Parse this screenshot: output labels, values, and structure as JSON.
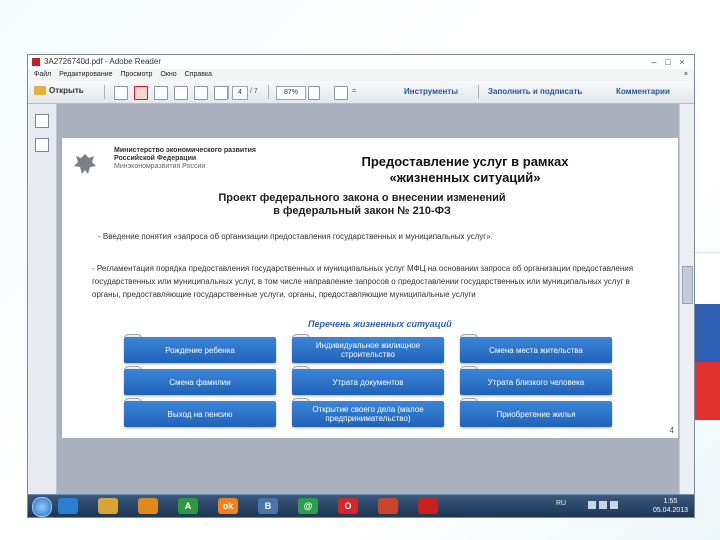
{
  "window": {
    "title": "3A2726740d.pdf - Adobe Reader",
    "minimize": "–",
    "maximize": "□",
    "close": "×"
  },
  "menubar": {
    "items": [
      "Файл",
      "Редактирование",
      "Просмотр",
      "Окно",
      "Справка"
    ],
    "close_doc": "×"
  },
  "toolbar": {
    "open_label": "Открыть",
    "page_current": "4",
    "page_total": "/ 7",
    "zoom": "87%",
    "tools": "Инструменты",
    "fill_sign": "Заполнить и подписать",
    "comments": "Комментарии"
  },
  "document": {
    "ministry_line1": "Министерство экономического развития",
    "ministry_line2": "Российской Федерации",
    "ministry_short": "Минэкономразвития России",
    "title_line1": "Предоставление услуг в рамках",
    "title_line2": "«жизненных ситуаций»",
    "project_line1": "Проект федерального закона о внесении изменений",
    "project_line2": "в федеральный закон № 210-ФЗ",
    "bullet1": "- Введение понятия «запроса об организации предоставления государственных и муниципальных услуг».",
    "bullet2": "- Регламентация порядка предоставления государственных и муниципальных услуг МФЦ на основании запроса об организации предоставления государственных или муниципальных услуг, в том числе направление запросов о предоставлении государственных или муниципальных услуг в органы, предоставляющие государственные услуги, органы, предоставляющие муниципальные услуги",
    "list_title": "Перечень жизненных ситуаций",
    "situations": [
      "Рождение ребенка",
      "Индивидуальное жилищное строительство",
      "Смена места жительства",
      "Смена фамилии",
      "Утрата документов",
      "Утрата близкого человека",
      "Выход на пенсию",
      "Открытие своего дела (малое предпринимательство)",
      "Приобретение жилья"
    ],
    "page_number": "4"
  },
  "taskbar": {
    "apps": [
      {
        "icon": "ie-icon",
        "label": "",
        "color": "#2a7fd4"
      },
      {
        "icon": "explorer-icon",
        "label": "",
        "color": "#d9a43a"
      },
      {
        "icon": "media-player-icon",
        "label": "",
        "color": "#e08a1e"
      },
      {
        "icon": "app-a-icon",
        "label": "A",
        "color": "#2d9a3e"
      },
      {
        "icon": "odnoklassniki-icon",
        "label": "ok",
        "color": "#f0821e"
      },
      {
        "icon": "vk-icon",
        "label": "В",
        "color": "#4a76a8"
      },
      {
        "icon": "mail-agent-icon",
        "label": "@",
        "color": "#2e9e4a"
      },
      {
        "icon": "opera-icon",
        "label": "O",
        "color": "#d2262b"
      },
      {
        "icon": "presentation-icon",
        "label": "",
        "color": "#c8462b"
      },
      {
        "icon": "adobe-reader-icon",
        "label": "",
        "color": "#c8201f"
      }
    ],
    "language": "RU",
    "time": "1:55",
    "date": "05.04.2013"
  }
}
